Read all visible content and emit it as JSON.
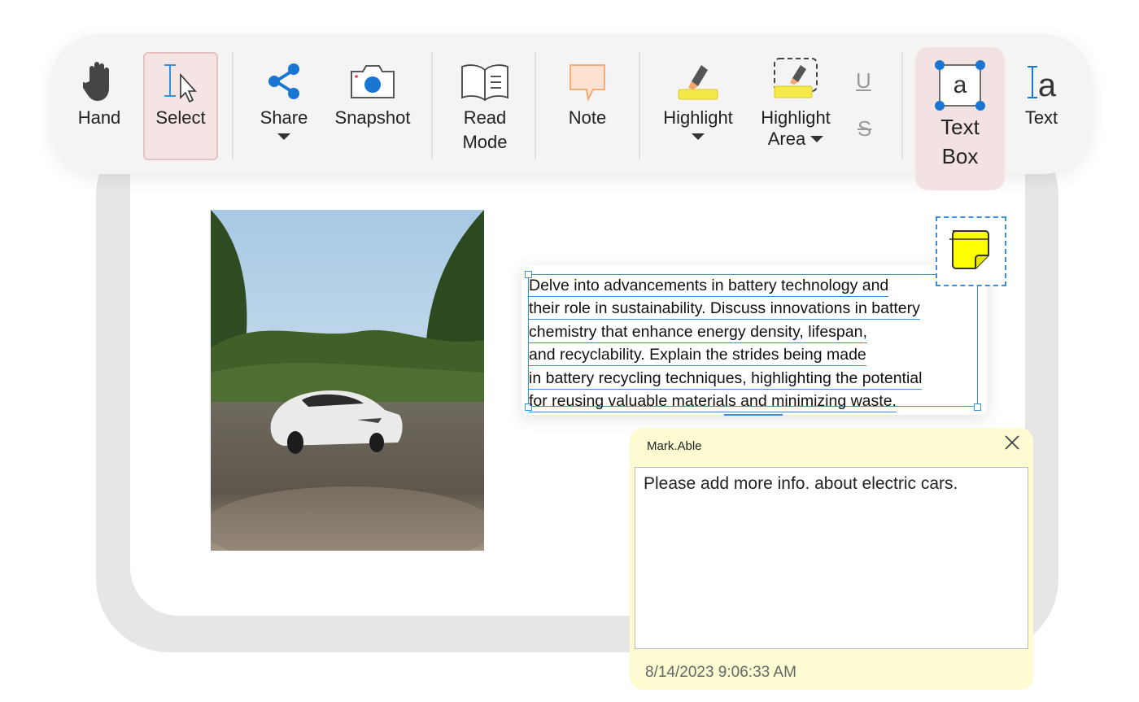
{
  "toolbar": {
    "hand_label": "Hand",
    "select_label": "Select",
    "share_label": "Share",
    "snapshot_label": "Snapshot",
    "read_mode_label_1": "Read",
    "read_mode_label_2": "Mode",
    "note_label": "Note",
    "highlight_label": "Highlight",
    "highlight_area_label_1": "Highlight",
    "highlight_area_label_2": "Area",
    "underline_glyph": "U",
    "strikethrough_glyph": "S",
    "text_box_label_1": "Text",
    "text_box_label_2": "Box",
    "text_box_glyph": "a",
    "text_label": "Text",
    "text_glyph": "a"
  },
  "document": {
    "paragraph_lines": [
      "Delve into advancements in battery technology and",
      "their role in sustainability. Discuss innovations in battery",
      "chemistry that enhance energy density, lifespan,",
      "and recyclability. Explain the strides being made",
      "in battery recycling techniques, highlighting the potential",
      "for reusing valuable materials and minimizing waste."
    ]
  },
  "popup_note": {
    "author": "Mark.Able",
    "comment": "Please add more info. about electric cars.",
    "date": "8/14/2023 9:06:33 AM"
  },
  "colors": {
    "accent_blue": "#3a8fd8",
    "share_blue": "#1976d2",
    "highlight_yellow": "#f5e94a",
    "note_orange": "#f5a56a",
    "sticky_yellow": "#ffff00",
    "popup_bg": "#fdfbd2"
  }
}
